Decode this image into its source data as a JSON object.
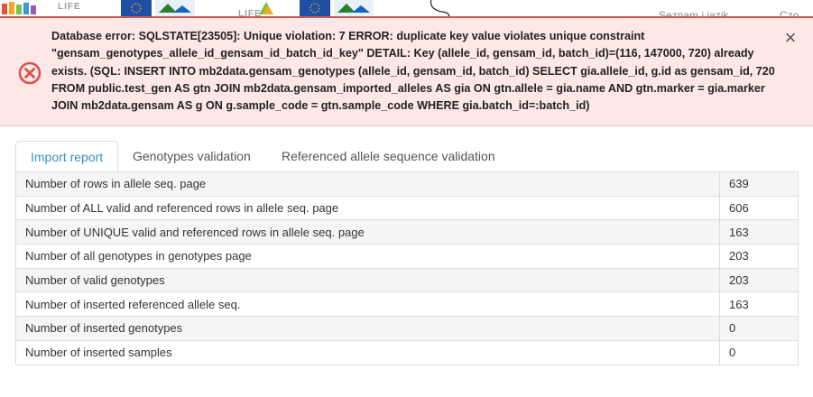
{
  "background": {
    "logo_text_1": "LIFE",
    "logo_text_2": "LIFE",
    "right_link_1": "Seznam i jazik",
    "right_link_2": "Czo"
  },
  "alert": {
    "icon": "error-circle-x-icon",
    "message": "Database error: SQLSTATE[23505]: Unique violation: 7 ERROR: duplicate key value violates unique constraint \"gensam_genotypes_allele_id_gensam_id_batch_id_key\" DETAIL: Key (allele_id, gensam_id, batch_id)=(116, 147000, 720) already exists. (SQL: INSERT INTO mb2data.gensam_genotypes (allele_id, gensam_id, batch_id) SELECT gia.allele_id, g.id as gensam_id, 720 FROM public.test_gen AS gtn JOIN mb2data.gensam_imported_alleles AS gia ON gtn.allele = gia.name AND gtn.marker = gia.marker JOIN mb2data.gensam AS g ON g.sample_code = gtn.sample_code WHERE gia.batch_id=:batch_id)",
    "close_label": "×",
    "color": "#d9534f"
  },
  "tabs": [
    {
      "label": "Import report",
      "active": true
    },
    {
      "label": "Genotypes validation",
      "active": false
    },
    {
      "label": "Referenced allele sequence validation",
      "active": false
    }
  ],
  "report_rows": [
    {
      "label": "Number of rows in allele seq. page",
      "value": "639"
    },
    {
      "label": "Number of ALL valid and referenced rows in allele seq. page",
      "value": "606"
    },
    {
      "label": "Number of UNIQUE valid and referenced rows in allele seq. page",
      "value": "163"
    },
    {
      "label": "Number of all genotypes in genotypes page",
      "value": "203"
    },
    {
      "label": "Number of valid genotypes",
      "value": "203"
    },
    {
      "label": "Number of inserted referenced allele seq.",
      "value": "163"
    },
    {
      "label": "Number of inserted genotypes",
      "value": "0"
    },
    {
      "label": "Number of inserted samples",
      "value": "0"
    }
  ]
}
